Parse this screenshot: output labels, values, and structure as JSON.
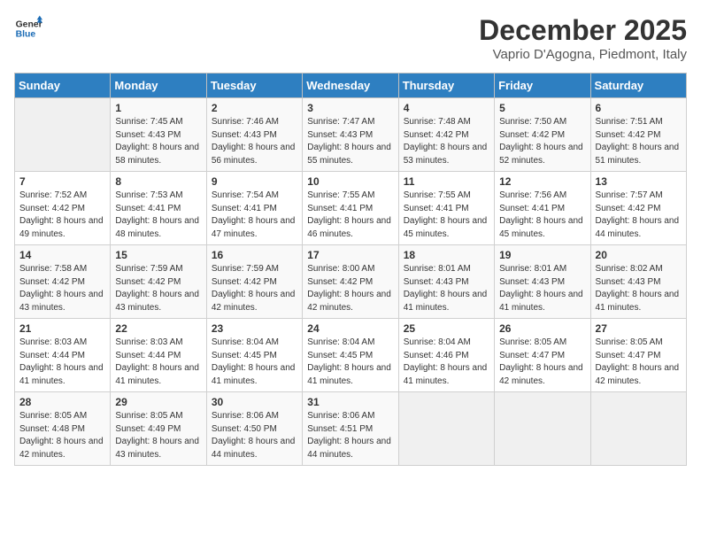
{
  "header": {
    "logo_line1": "General",
    "logo_line2": "Blue",
    "month_title": "December 2025",
    "subtitle": "Vaprio D'Agogna, Piedmont, Italy"
  },
  "days_of_week": [
    "Sunday",
    "Monday",
    "Tuesday",
    "Wednesday",
    "Thursday",
    "Friday",
    "Saturday"
  ],
  "weeks": [
    [
      {
        "day": "",
        "sunrise": "",
        "sunset": "",
        "daylight": "",
        "empty": true
      },
      {
        "day": "1",
        "sunrise": "Sunrise: 7:45 AM",
        "sunset": "Sunset: 4:43 PM",
        "daylight": "Daylight: 8 hours and 58 minutes."
      },
      {
        "day": "2",
        "sunrise": "Sunrise: 7:46 AM",
        "sunset": "Sunset: 4:43 PM",
        "daylight": "Daylight: 8 hours and 56 minutes."
      },
      {
        "day": "3",
        "sunrise": "Sunrise: 7:47 AM",
        "sunset": "Sunset: 4:43 PM",
        "daylight": "Daylight: 8 hours and 55 minutes."
      },
      {
        "day": "4",
        "sunrise": "Sunrise: 7:48 AM",
        "sunset": "Sunset: 4:42 PM",
        "daylight": "Daylight: 8 hours and 53 minutes."
      },
      {
        "day": "5",
        "sunrise": "Sunrise: 7:50 AM",
        "sunset": "Sunset: 4:42 PM",
        "daylight": "Daylight: 8 hours and 52 minutes."
      },
      {
        "day": "6",
        "sunrise": "Sunrise: 7:51 AM",
        "sunset": "Sunset: 4:42 PM",
        "daylight": "Daylight: 8 hours and 51 minutes."
      }
    ],
    [
      {
        "day": "7",
        "sunrise": "Sunrise: 7:52 AM",
        "sunset": "Sunset: 4:42 PM",
        "daylight": "Daylight: 8 hours and 49 minutes."
      },
      {
        "day": "8",
        "sunrise": "Sunrise: 7:53 AM",
        "sunset": "Sunset: 4:41 PM",
        "daylight": "Daylight: 8 hours and 48 minutes."
      },
      {
        "day": "9",
        "sunrise": "Sunrise: 7:54 AM",
        "sunset": "Sunset: 4:41 PM",
        "daylight": "Daylight: 8 hours and 47 minutes."
      },
      {
        "day": "10",
        "sunrise": "Sunrise: 7:55 AM",
        "sunset": "Sunset: 4:41 PM",
        "daylight": "Daylight: 8 hours and 46 minutes."
      },
      {
        "day": "11",
        "sunrise": "Sunrise: 7:55 AM",
        "sunset": "Sunset: 4:41 PM",
        "daylight": "Daylight: 8 hours and 45 minutes."
      },
      {
        "day": "12",
        "sunrise": "Sunrise: 7:56 AM",
        "sunset": "Sunset: 4:41 PM",
        "daylight": "Daylight: 8 hours and 45 minutes."
      },
      {
        "day": "13",
        "sunrise": "Sunrise: 7:57 AM",
        "sunset": "Sunset: 4:42 PM",
        "daylight": "Daylight: 8 hours and 44 minutes."
      }
    ],
    [
      {
        "day": "14",
        "sunrise": "Sunrise: 7:58 AM",
        "sunset": "Sunset: 4:42 PM",
        "daylight": "Daylight: 8 hours and 43 minutes."
      },
      {
        "day": "15",
        "sunrise": "Sunrise: 7:59 AM",
        "sunset": "Sunset: 4:42 PM",
        "daylight": "Daylight: 8 hours and 43 minutes."
      },
      {
        "day": "16",
        "sunrise": "Sunrise: 7:59 AM",
        "sunset": "Sunset: 4:42 PM",
        "daylight": "Daylight: 8 hours and 42 minutes."
      },
      {
        "day": "17",
        "sunrise": "Sunrise: 8:00 AM",
        "sunset": "Sunset: 4:42 PM",
        "daylight": "Daylight: 8 hours and 42 minutes."
      },
      {
        "day": "18",
        "sunrise": "Sunrise: 8:01 AM",
        "sunset": "Sunset: 4:43 PM",
        "daylight": "Daylight: 8 hours and 41 minutes."
      },
      {
        "day": "19",
        "sunrise": "Sunrise: 8:01 AM",
        "sunset": "Sunset: 4:43 PM",
        "daylight": "Daylight: 8 hours and 41 minutes."
      },
      {
        "day": "20",
        "sunrise": "Sunrise: 8:02 AM",
        "sunset": "Sunset: 4:43 PM",
        "daylight": "Daylight: 8 hours and 41 minutes."
      }
    ],
    [
      {
        "day": "21",
        "sunrise": "Sunrise: 8:03 AM",
        "sunset": "Sunset: 4:44 PM",
        "daylight": "Daylight: 8 hours and 41 minutes."
      },
      {
        "day": "22",
        "sunrise": "Sunrise: 8:03 AM",
        "sunset": "Sunset: 4:44 PM",
        "daylight": "Daylight: 8 hours and 41 minutes."
      },
      {
        "day": "23",
        "sunrise": "Sunrise: 8:04 AM",
        "sunset": "Sunset: 4:45 PM",
        "daylight": "Daylight: 8 hours and 41 minutes."
      },
      {
        "day": "24",
        "sunrise": "Sunrise: 8:04 AM",
        "sunset": "Sunset: 4:45 PM",
        "daylight": "Daylight: 8 hours and 41 minutes."
      },
      {
        "day": "25",
        "sunrise": "Sunrise: 8:04 AM",
        "sunset": "Sunset: 4:46 PM",
        "daylight": "Daylight: 8 hours and 41 minutes."
      },
      {
        "day": "26",
        "sunrise": "Sunrise: 8:05 AM",
        "sunset": "Sunset: 4:47 PM",
        "daylight": "Daylight: 8 hours and 42 minutes."
      },
      {
        "day": "27",
        "sunrise": "Sunrise: 8:05 AM",
        "sunset": "Sunset: 4:47 PM",
        "daylight": "Daylight: 8 hours and 42 minutes."
      }
    ],
    [
      {
        "day": "28",
        "sunrise": "Sunrise: 8:05 AM",
        "sunset": "Sunset: 4:48 PM",
        "daylight": "Daylight: 8 hours and 42 minutes."
      },
      {
        "day": "29",
        "sunrise": "Sunrise: 8:05 AM",
        "sunset": "Sunset: 4:49 PM",
        "daylight": "Daylight: 8 hours and 43 minutes."
      },
      {
        "day": "30",
        "sunrise": "Sunrise: 8:06 AM",
        "sunset": "Sunset: 4:50 PM",
        "daylight": "Daylight: 8 hours and 44 minutes."
      },
      {
        "day": "31",
        "sunrise": "Sunrise: 8:06 AM",
        "sunset": "Sunset: 4:51 PM",
        "daylight": "Daylight: 8 hours and 44 minutes."
      },
      {
        "day": "",
        "sunrise": "",
        "sunset": "",
        "daylight": "",
        "empty": true
      },
      {
        "day": "",
        "sunrise": "",
        "sunset": "",
        "daylight": "",
        "empty": true
      },
      {
        "day": "",
        "sunrise": "",
        "sunset": "",
        "daylight": "",
        "empty": true
      }
    ]
  ]
}
